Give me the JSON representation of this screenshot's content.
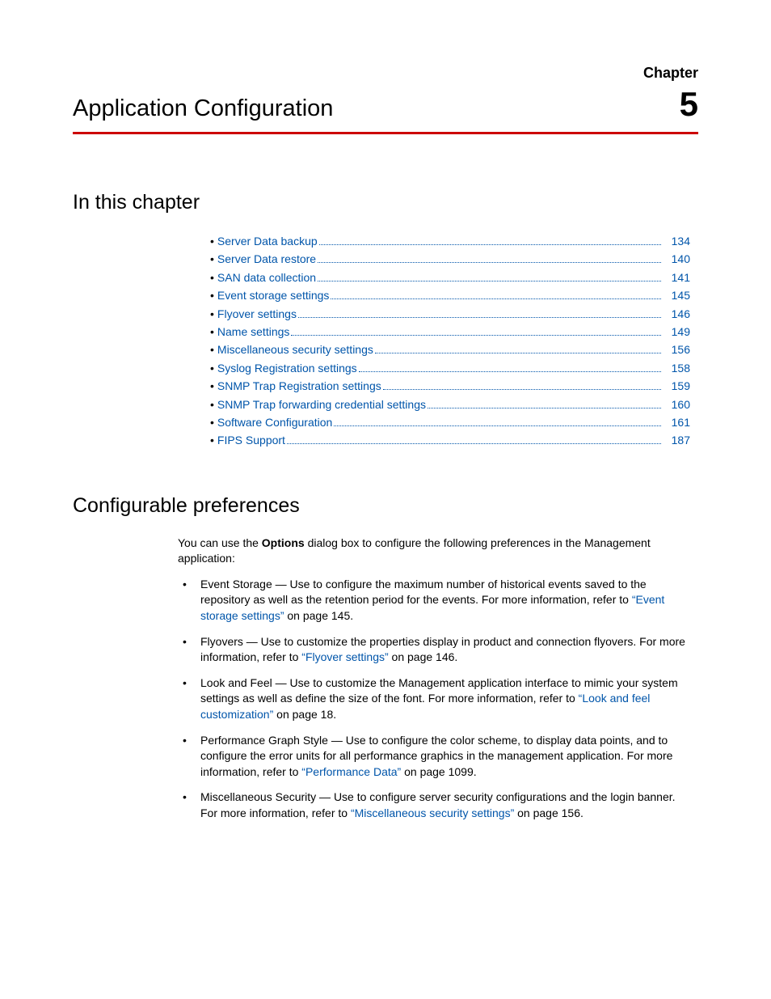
{
  "header": {
    "chapter_label": "Chapter",
    "title": "Application Configuration",
    "number": "5"
  },
  "section1": {
    "heading": "In this chapter",
    "toc": [
      {
        "label": "Server Data backup",
        "page": "134"
      },
      {
        "label": "Server Data restore",
        "page": "140"
      },
      {
        "label": "SAN data collection",
        "page": "141"
      },
      {
        "label": "Event storage settings",
        "page": "145"
      },
      {
        "label": "Flyover settings",
        "page": "146"
      },
      {
        "label": "Name settings",
        "page": "149"
      },
      {
        "label": "Miscellaneous security settings",
        "page": "156"
      },
      {
        "label": "Syslog Registration settings",
        "page": "158"
      },
      {
        "label": "SNMP Trap Registration settings",
        "page": "159"
      },
      {
        "label": "SNMP Trap forwarding credential settings",
        "page": "160"
      },
      {
        "label": "Software Configuration",
        "page": "161"
      },
      {
        "label": "FIPS Support",
        "page": "187"
      }
    ]
  },
  "section2": {
    "heading": "Configurable preferences",
    "intro_pre": "You can use the ",
    "intro_bold": "Options",
    "intro_post": " dialog box to configure the following preferences in the Management application:",
    "items": [
      {
        "pre": "Event Storage — Use to configure the maximum number of historical events saved to the repository as well as the retention period for the events. For more information, refer to ",
        "link": "“Event storage settings”",
        "post": " on page 145."
      },
      {
        "pre": "Flyovers — Use to customize the properties display in product and connection flyovers. For more information, refer to ",
        "link": "“Flyover settings”",
        "post": " on page 146."
      },
      {
        "pre": "Look and Feel — Use to customize the Management application interface to mimic your system settings as well as define the size of the font. For more information, refer to ",
        "link": "“Look and feel customization”",
        "post": " on page 18."
      },
      {
        "pre": "Performance Graph Style — Use to configure the color scheme, to display data points, and to configure the error units for all performance graphics in the management application. For more information, refer to ",
        "link": "“Performance Data”",
        "post": " on page 1099."
      },
      {
        "pre": "Miscellaneous Security — Use to configure server security configurations and the login banner. For more information, refer to ",
        "link": "“Miscellaneous security settings”",
        "post": " on page 156."
      }
    ]
  }
}
